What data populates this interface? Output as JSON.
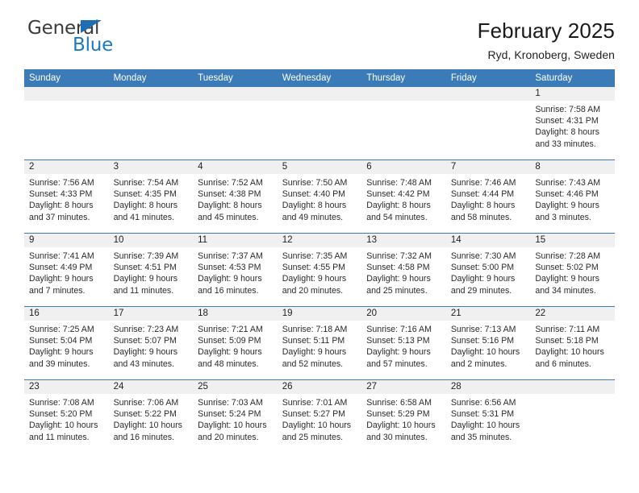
{
  "brand": {
    "name_top": "General",
    "name_bottom": "Blue",
    "triangle_color": "#1c6fb5",
    "text_color": "#3b3b3b",
    "blue_color": "#1c79c0"
  },
  "header": {
    "title": "February 2025",
    "subtitle": "Ryd, Kronoberg, Sweden"
  },
  "theme": {
    "header_bg": "#3b7cb8",
    "header_text": "#ffffff",
    "daynum_bg": "#f0f0f0",
    "cell_bg": "#ffffff",
    "rule_color": "#3b7cb8"
  },
  "weekday_headers": [
    "Sunday",
    "Monday",
    "Tuesday",
    "Wednesday",
    "Thursday",
    "Friday",
    "Saturday"
  ],
  "labels": {
    "sunrise_prefix": "Sunrise:",
    "sunset_prefix": "Sunset:",
    "daylight_prefix": "Daylight:"
  },
  "weeks": [
    [
      {
        "blank": true
      },
      {
        "blank": true
      },
      {
        "blank": true
      },
      {
        "blank": true
      },
      {
        "blank": true
      },
      {
        "blank": true
      },
      {
        "day": "1",
        "sunrise": "Sunrise: 7:58 AM",
        "sunset": "Sunset: 4:31 PM",
        "daylight_line1": "Daylight: 8 hours",
        "daylight_line2": "and 33 minutes."
      }
    ],
    [
      {
        "day": "2",
        "sunrise": "Sunrise: 7:56 AM",
        "sunset": "Sunset: 4:33 PM",
        "daylight_line1": "Daylight: 8 hours",
        "daylight_line2": "and 37 minutes."
      },
      {
        "day": "3",
        "sunrise": "Sunrise: 7:54 AM",
        "sunset": "Sunset: 4:35 PM",
        "daylight_line1": "Daylight: 8 hours",
        "daylight_line2": "and 41 minutes."
      },
      {
        "day": "4",
        "sunrise": "Sunrise: 7:52 AM",
        "sunset": "Sunset: 4:38 PM",
        "daylight_line1": "Daylight: 8 hours",
        "daylight_line2": "and 45 minutes."
      },
      {
        "day": "5",
        "sunrise": "Sunrise: 7:50 AM",
        "sunset": "Sunset: 4:40 PM",
        "daylight_line1": "Daylight: 8 hours",
        "daylight_line2": "and 49 minutes."
      },
      {
        "day": "6",
        "sunrise": "Sunrise: 7:48 AM",
        "sunset": "Sunset: 4:42 PM",
        "daylight_line1": "Daylight: 8 hours",
        "daylight_line2": "and 54 minutes."
      },
      {
        "day": "7",
        "sunrise": "Sunrise: 7:46 AM",
        "sunset": "Sunset: 4:44 PM",
        "daylight_line1": "Daylight: 8 hours",
        "daylight_line2": "and 58 minutes."
      },
      {
        "day": "8",
        "sunrise": "Sunrise: 7:43 AM",
        "sunset": "Sunset: 4:46 PM",
        "daylight_line1": "Daylight: 9 hours",
        "daylight_line2": "and 3 minutes."
      }
    ],
    [
      {
        "day": "9",
        "sunrise": "Sunrise: 7:41 AM",
        "sunset": "Sunset: 4:49 PM",
        "daylight_line1": "Daylight: 9 hours",
        "daylight_line2": "and 7 minutes."
      },
      {
        "day": "10",
        "sunrise": "Sunrise: 7:39 AM",
        "sunset": "Sunset: 4:51 PM",
        "daylight_line1": "Daylight: 9 hours",
        "daylight_line2": "and 11 minutes."
      },
      {
        "day": "11",
        "sunrise": "Sunrise: 7:37 AM",
        "sunset": "Sunset: 4:53 PM",
        "daylight_line1": "Daylight: 9 hours",
        "daylight_line2": "and 16 minutes."
      },
      {
        "day": "12",
        "sunrise": "Sunrise: 7:35 AM",
        "sunset": "Sunset: 4:55 PM",
        "daylight_line1": "Daylight: 9 hours",
        "daylight_line2": "and 20 minutes."
      },
      {
        "day": "13",
        "sunrise": "Sunrise: 7:32 AM",
        "sunset": "Sunset: 4:58 PM",
        "daylight_line1": "Daylight: 9 hours",
        "daylight_line2": "and 25 minutes."
      },
      {
        "day": "14",
        "sunrise": "Sunrise: 7:30 AM",
        "sunset": "Sunset: 5:00 PM",
        "daylight_line1": "Daylight: 9 hours",
        "daylight_line2": "and 29 minutes."
      },
      {
        "day": "15",
        "sunrise": "Sunrise: 7:28 AM",
        "sunset": "Sunset: 5:02 PM",
        "daylight_line1": "Daylight: 9 hours",
        "daylight_line2": "and 34 minutes."
      }
    ],
    [
      {
        "day": "16",
        "sunrise": "Sunrise: 7:25 AM",
        "sunset": "Sunset: 5:04 PM",
        "daylight_line1": "Daylight: 9 hours",
        "daylight_line2": "and 39 minutes."
      },
      {
        "day": "17",
        "sunrise": "Sunrise: 7:23 AM",
        "sunset": "Sunset: 5:07 PM",
        "daylight_line1": "Daylight: 9 hours",
        "daylight_line2": "and 43 minutes."
      },
      {
        "day": "18",
        "sunrise": "Sunrise: 7:21 AM",
        "sunset": "Sunset: 5:09 PM",
        "daylight_line1": "Daylight: 9 hours",
        "daylight_line2": "and 48 minutes."
      },
      {
        "day": "19",
        "sunrise": "Sunrise: 7:18 AM",
        "sunset": "Sunset: 5:11 PM",
        "daylight_line1": "Daylight: 9 hours",
        "daylight_line2": "and 52 minutes."
      },
      {
        "day": "20",
        "sunrise": "Sunrise: 7:16 AM",
        "sunset": "Sunset: 5:13 PM",
        "daylight_line1": "Daylight: 9 hours",
        "daylight_line2": "and 57 minutes."
      },
      {
        "day": "21",
        "sunrise": "Sunrise: 7:13 AM",
        "sunset": "Sunset: 5:16 PM",
        "daylight_line1": "Daylight: 10 hours",
        "daylight_line2": "and 2 minutes."
      },
      {
        "day": "22",
        "sunrise": "Sunrise: 7:11 AM",
        "sunset": "Sunset: 5:18 PM",
        "daylight_line1": "Daylight: 10 hours",
        "daylight_line2": "and 6 minutes."
      }
    ],
    [
      {
        "day": "23",
        "sunrise": "Sunrise: 7:08 AM",
        "sunset": "Sunset: 5:20 PM",
        "daylight_line1": "Daylight: 10 hours",
        "daylight_line2": "and 11 minutes."
      },
      {
        "day": "24",
        "sunrise": "Sunrise: 7:06 AM",
        "sunset": "Sunset: 5:22 PM",
        "daylight_line1": "Daylight: 10 hours",
        "daylight_line2": "and 16 minutes."
      },
      {
        "day": "25",
        "sunrise": "Sunrise: 7:03 AM",
        "sunset": "Sunset: 5:24 PM",
        "daylight_line1": "Daylight: 10 hours",
        "daylight_line2": "and 20 minutes."
      },
      {
        "day": "26",
        "sunrise": "Sunrise: 7:01 AM",
        "sunset": "Sunset: 5:27 PM",
        "daylight_line1": "Daylight: 10 hours",
        "daylight_line2": "and 25 minutes."
      },
      {
        "day": "27",
        "sunrise": "Sunrise: 6:58 AM",
        "sunset": "Sunset: 5:29 PM",
        "daylight_line1": "Daylight: 10 hours",
        "daylight_line2": "and 30 minutes."
      },
      {
        "day": "28",
        "sunrise": "Sunrise: 6:56 AM",
        "sunset": "Sunset: 5:31 PM",
        "daylight_line1": "Daylight: 10 hours",
        "daylight_line2": "and 35 minutes."
      },
      {
        "blank": true
      }
    ]
  ]
}
